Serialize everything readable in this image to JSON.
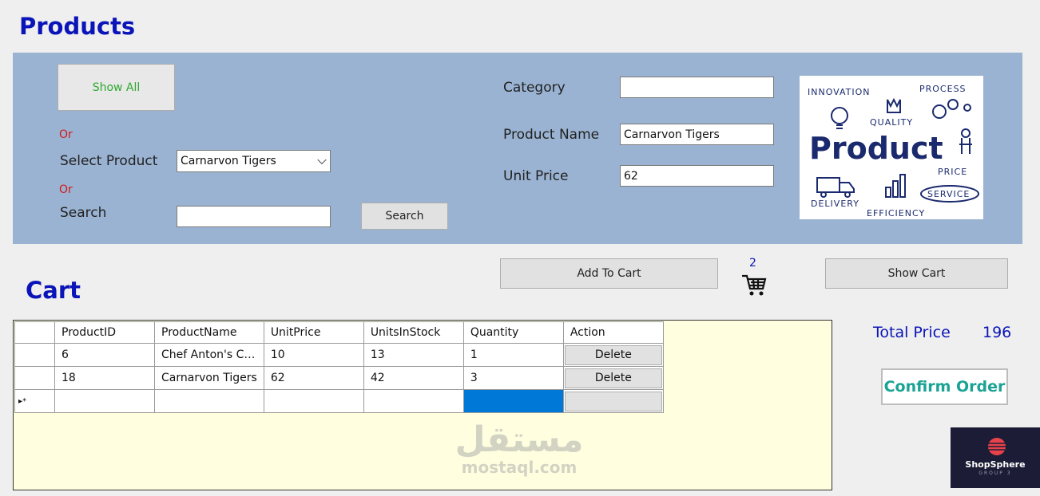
{
  "products_section": {
    "title": "Products",
    "show_all_label": "Show All",
    "or_label_1": "Or",
    "or_label_2": "Or",
    "select_product_label": "Select Product",
    "select_product_value": "Carnarvon Tigers",
    "search_label": "Search",
    "search_value": "",
    "search_button_label": "Search",
    "category_label": "Category",
    "category_value": "",
    "product_name_label": "Product Name",
    "product_name_value": "Carnarvon Tigers",
    "unit_price_label": "Unit Price",
    "unit_price_value": "62",
    "image": {
      "words": [
        "INNOVATION",
        "PROCESS",
        "QUALITY",
        "Product",
        "PRICE",
        "DELIVERY",
        "SERVICE",
        "EFFICIENCY"
      ]
    }
  },
  "actions": {
    "add_to_cart_label": "Add To Cart",
    "cart_count": "2",
    "show_cart_label": "Show Cart"
  },
  "cart_section": {
    "title": "Cart",
    "columns": [
      "ProductID",
      "ProductName",
      "UnitPrice",
      "UnitsInStock",
      "Quantity",
      "Action"
    ],
    "rows": [
      {
        "ProductID": "6",
        "ProductName": "Chef Anton's Ca...",
        "UnitPrice": "10",
        "UnitsInStock": "13",
        "Quantity": "1",
        "Action": "Delete"
      },
      {
        "ProductID": "18",
        "ProductName": "Carnarvon Tigers",
        "UnitPrice": "62",
        "UnitsInStock": "42",
        "Quantity": "3",
        "Action": "Delete"
      }
    ],
    "new_row_marker": "▸*"
  },
  "totals": {
    "total_price_label": "Total Price",
    "total_price_value": "196",
    "confirm_label": "Confirm Order"
  },
  "watermark": {
    "arabic": "مستقل",
    "latin": "mostaql.com"
  },
  "brand": {
    "name": "ShopSphere",
    "subtitle": "GROUP 3"
  },
  "colors": {
    "title": "#0a14b8",
    "panel": "#9ab3d2",
    "show_all_text": "#2fa82f",
    "or_text": "#d21a1a",
    "confirm_text": "#1aa394",
    "selection": "#0078d7",
    "grid_bg": "#ffffe0"
  }
}
